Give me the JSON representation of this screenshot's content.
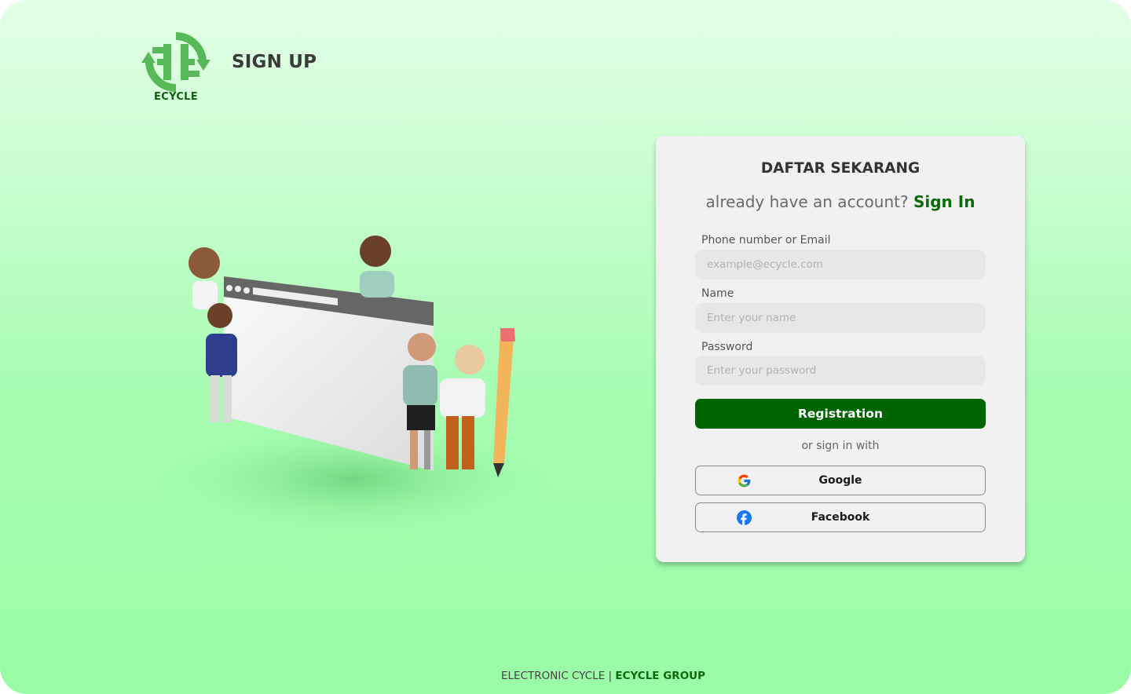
{
  "header": {
    "brand_name": "ECYCLE",
    "page_title": "SIGN UP"
  },
  "card": {
    "title": "DAFTAR SEKARANG",
    "subtitle": "already have an account?",
    "signin_link": "Sign In",
    "fields": [
      {
        "label": "Phone number or Email",
        "placeholder": "example@ecycle.com",
        "value": ""
      },
      {
        "label": "Name",
        "placeholder": "Enter your name",
        "value": ""
      },
      {
        "label": "Password",
        "placeholder": "Enter your password",
        "value": ""
      }
    ],
    "register_label": "Registration",
    "or_text": "or sign in with",
    "social": [
      {
        "label": "Google",
        "icon": "google-icon"
      },
      {
        "label": "Facebook",
        "icon": "facebook-icon"
      }
    ]
  },
  "footer": {
    "left": "ELECTRONIC CYCLE",
    "separator": " | ",
    "right": "ECYCLE GROUP"
  },
  "colors": {
    "brand_green": "#006400",
    "link_green": "#0c6a0c",
    "background_top": "#e3ffe7",
    "background_bottom": "#99fca6",
    "card_bg": "#f1f1f1"
  }
}
